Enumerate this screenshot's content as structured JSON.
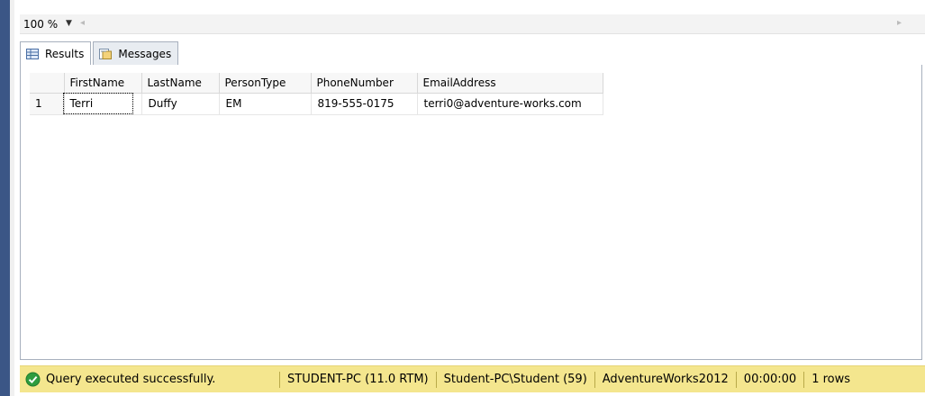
{
  "toolbar": {
    "zoom": "100 %"
  },
  "tabs": [
    {
      "label": "Results"
    },
    {
      "label": "Messages"
    }
  ],
  "grid": {
    "columns": [
      "FirstName",
      "LastName",
      "PersonType",
      "PhoneNumber",
      "EmailAddress"
    ],
    "rows": [
      {
        "num": "1",
        "cells": [
          "Terri",
          "Duffy",
          "EM",
          "819-555-0175",
          "terri0@adventure-works.com"
        ]
      }
    ]
  },
  "status": {
    "message": "Query executed successfully.",
    "server": "STUDENT-PC (11.0 RTM)",
    "user": "Student-PC\\Student (59)",
    "database": "AdventureWorks2012",
    "elapsed": "00:00:00",
    "rows": "1 rows"
  },
  "colors": {
    "status_bg": "#f4e68e",
    "left_bar": "#3b5686",
    "ok_icon": "#2e9c3e"
  }
}
